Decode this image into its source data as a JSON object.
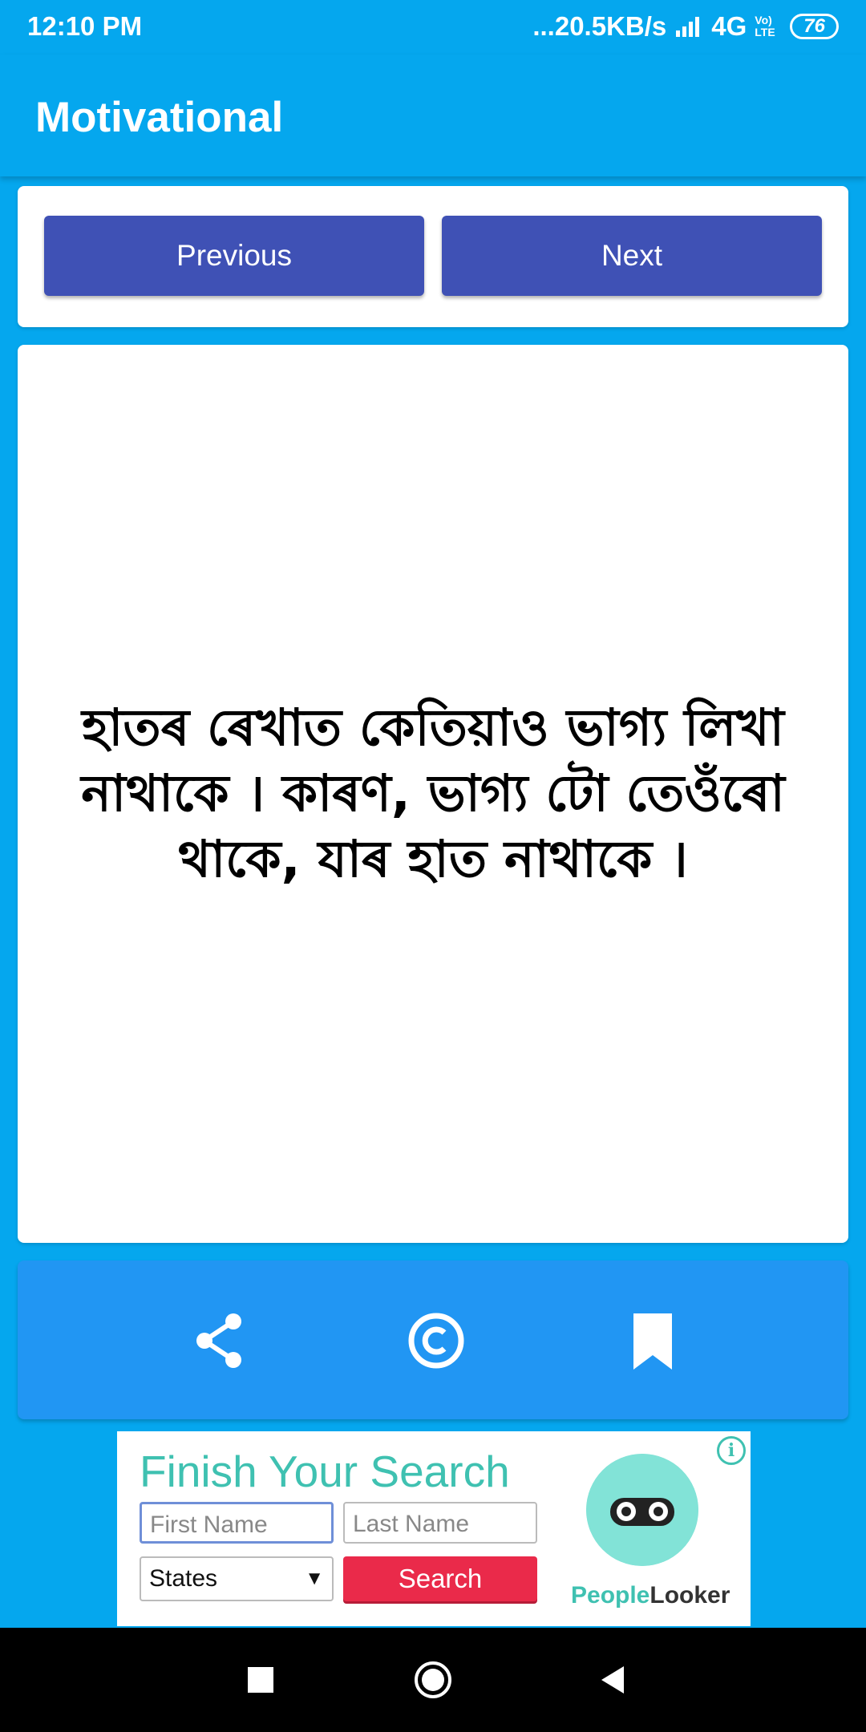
{
  "status_bar": {
    "time": "12:10 PM",
    "network_speed": "...20.5KB/s",
    "network_type": "4G",
    "volte": "Vo) LTE",
    "battery": "76"
  },
  "app_bar": {
    "title": "Motivational"
  },
  "navigation": {
    "previous_label": "Previous",
    "next_label": "Next"
  },
  "quote": {
    "text": "হাতৰ ৰেখাত কেতিয়াও ভাগ্য লিখা নাথাকে । কাৰণ, ভাগ্য টো তেওঁৰো থাকে, যাৰ হাত নাথাকে ।"
  },
  "actions": {
    "icons": [
      "share-icon",
      "copyright-icon",
      "bookmark-icon"
    ]
  },
  "ad": {
    "title": "Finish Your Search",
    "first_name_placeholder": "First Name",
    "last_name_placeholder": "Last Name",
    "states_label": "States",
    "search_label": "Search",
    "brand_part1": "People",
    "brand_part2": "Looker",
    "info_symbol": "i"
  },
  "colors": {
    "primary": "#05a7ee",
    "button": "#3f51b5",
    "action_bar": "#2196f3",
    "ad_accent": "#3fc1b1",
    "ad_search": "#ea2a4a"
  }
}
